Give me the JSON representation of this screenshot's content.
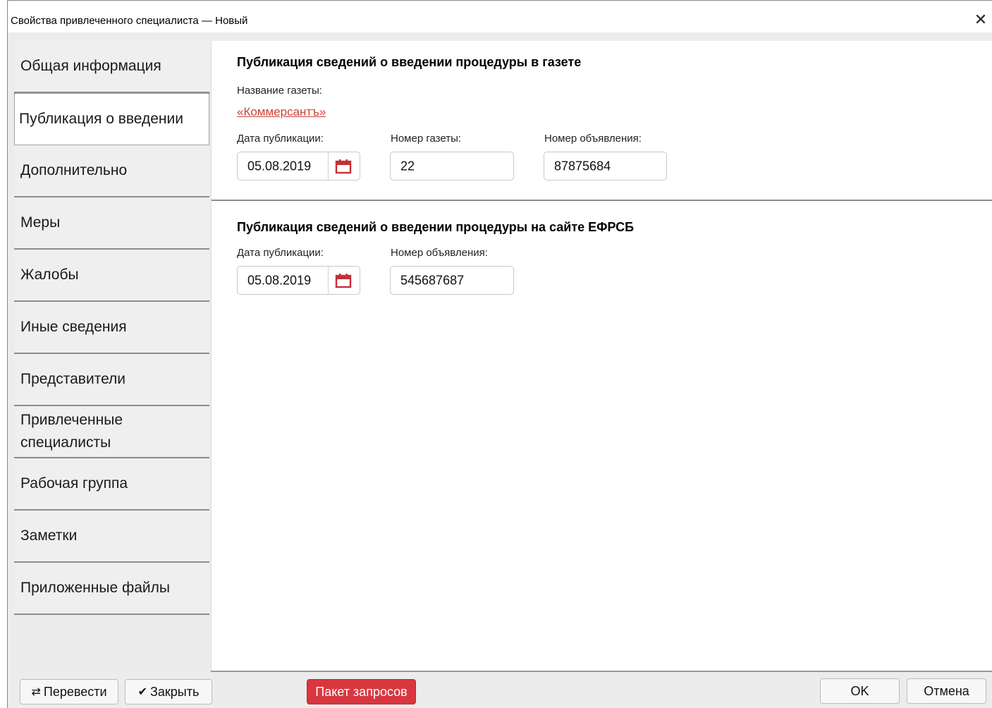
{
  "window": {
    "title": "Свойства привлеченного специалиста — Новый",
    "close_glyph": "✕"
  },
  "sidebar": {
    "items": [
      {
        "label": "Общая информация",
        "active": false
      },
      {
        "label": "Публикация о введении",
        "active": true
      },
      {
        "label": "Дополнительно",
        "active": false
      },
      {
        "label": "Меры",
        "active": false
      },
      {
        "label": "Жалобы",
        "active": false
      },
      {
        "label": "Иные сведения",
        "active": false
      },
      {
        "label": "Представители",
        "active": false
      },
      {
        "label": "Привлеченные специалисты",
        "active": false
      },
      {
        "label": "Рабочая группа",
        "active": false
      },
      {
        "label": "Заметки",
        "active": false
      },
      {
        "label": "Приложенные файлы",
        "active": false
      }
    ]
  },
  "newspaper": {
    "title": "Публикация сведений о введении процедуры в газете",
    "name_label": "Название газеты:",
    "name_value": "«Коммерсантъ»",
    "date_label": "Дата публикации:",
    "date_value": "05.08.2019",
    "issue_label": "Номер газеты:",
    "issue_value": "22",
    "ad_label": "Номер объявления:",
    "ad_value": "87875684"
  },
  "efrsb": {
    "title": "Публикация сведений о введении процедуры на сайте ЕФРСБ",
    "date_label": "Дата публикации:",
    "date_value": "05.08.2019",
    "ad_label": "Номер объявления:",
    "ad_value": "545687687"
  },
  "footer": {
    "transfer_label": "Перевести",
    "transfer_icon": "⇄",
    "close_label": "Закрыть",
    "close_icon": "✔",
    "batch_label": "Пакет запросов",
    "ok_label": "OK",
    "cancel_label": "Отмена"
  },
  "colors": {
    "accent_red": "#d9373f",
    "link_red": "#c8443a",
    "calendar_red": "#c62f38"
  }
}
